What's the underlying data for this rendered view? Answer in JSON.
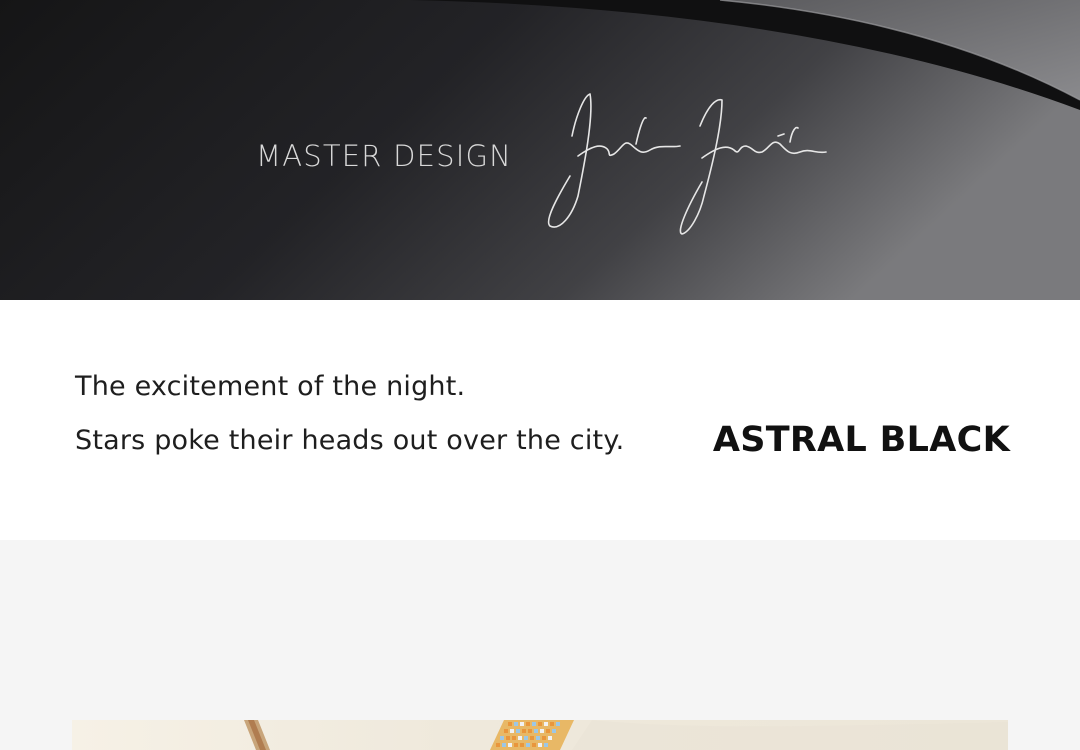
{
  "hero": {
    "title": "MASTER DESIGN",
    "signature_icon": "designer-signature",
    "background_color": "#121213"
  },
  "tagline": {
    "line1": "The excitement of the night.",
    "line2": "Stars poke their heads out over the city.",
    "product_name": "ASTRAL BLACK"
  },
  "product_image": {
    "icon": "leather-product-image"
  },
  "colors": {
    "text_dark": "#1e1e1e",
    "grey_bg": "#f5f5f5",
    "hero_text": "#d8d8d8"
  }
}
